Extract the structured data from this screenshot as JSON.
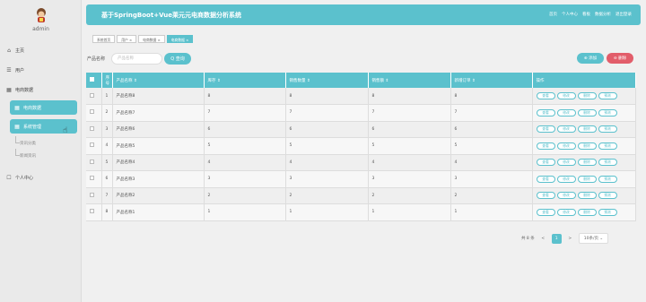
{
  "sidebar": {
    "username": "admin",
    "items": [
      {
        "label": "主页",
        "icon": "home-icon",
        "glyph": "⌂"
      },
      {
        "label": "用户",
        "icon": "users-icon",
        "glyph": "☰"
      },
      {
        "label": "电商数据",
        "icon": "grid-icon",
        "glyph": "▦"
      },
      {
        "label": "电商数据",
        "icon": "grid-icon",
        "glyph": "▦"
      },
      {
        "label": "系统管理",
        "icon": "grid-icon",
        "glyph": "▦"
      }
    ],
    "subitems": [
      "资讯分类",
      "新闻资讯"
    ],
    "profile": {
      "label": "个人中心",
      "icon": "person-icon",
      "glyph": "☐"
    }
  },
  "header": {
    "title": "基于SpringBoot+Vue莱元元电商数据分析系统",
    "links": [
      "首页",
      "个人中心",
      "看板",
      "数据分析",
      "退出登录"
    ]
  },
  "breadcrumbs": [
    "系统首页",
    "用户 ×",
    "电商数据 ×",
    "电商数据 ×"
  ],
  "search": {
    "label": "产品名称",
    "placeholder": "产品名称",
    "button": "Q 查询"
  },
  "actions": {
    "add": "⊕ 添加",
    "delete": "⊖ 删除"
  },
  "table": {
    "headers": [
      "",
      "序号",
      "产品名称 ⇕",
      "库存 ⇕",
      "销售数量 ⇕",
      "销售额 ⇕",
      "新增订单 ⇕",
      "操作"
    ],
    "rows": [
      [
        "1",
        "产品名称8",
        "8",
        "8",
        "8",
        "8"
      ],
      [
        "2",
        "产品名称7",
        "7",
        "7",
        "7",
        "7"
      ],
      [
        "3",
        "产品名称6",
        "6",
        "6",
        "6",
        "6"
      ],
      [
        "4",
        "产品名称5",
        "5",
        "5",
        "5",
        "5"
      ],
      [
        "5",
        "产品名称4",
        "4",
        "4",
        "4",
        "4"
      ],
      [
        "6",
        "产品名称3",
        "3",
        "3",
        "3",
        "3"
      ],
      [
        "7",
        "产品名称2",
        "2",
        "2",
        "2",
        "2"
      ],
      [
        "8",
        "产品名称1",
        "1",
        "1",
        "1",
        "1"
      ]
    ],
    "row_actions": [
      "查看",
      "修改",
      "删除",
      "预测"
    ]
  },
  "pagination": {
    "total": "共 8 条",
    "prev": "<",
    "current": "1",
    "next": ">",
    "page_size": "10条/页 ⌄"
  },
  "colors": {
    "primary": "#5bc1cd",
    "danger": "#e25d6a"
  }
}
